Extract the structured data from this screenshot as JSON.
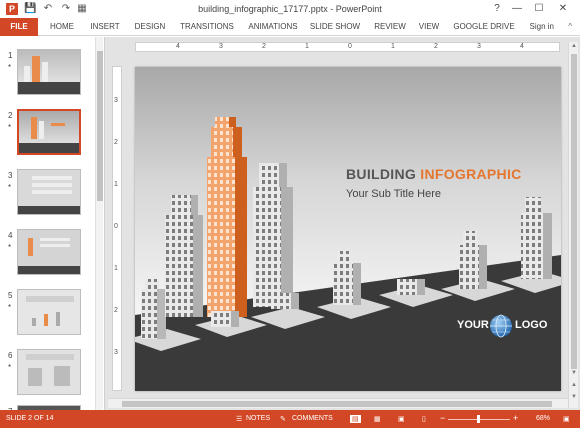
{
  "window": {
    "title": "building_infographic_17177.pptx - PowerPoint",
    "app_icon": "P",
    "controls": [
      "?",
      "—",
      "☐",
      "✕"
    ],
    "quick_access": [
      "save-icon",
      "undo-icon",
      "redo-icon",
      "start-icon"
    ]
  },
  "ribbon": {
    "tabs": [
      "FILE",
      "HOME",
      "INSERT",
      "DESIGN",
      "TRANSITIONS",
      "ANIMATIONS",
      "SLIDE SHOW",
      "REVIEW",
      "VIEW",
      "GOOGLE DRIVE"
    ],
    "signin": "Sign in",
    "collapse": "^"
  },
  "thumbnails": [
    {
      "num": "1",
      "star": "*"
    },
    {
      "num": "2",
      "star": "*"
    },
    {
      "num": "3",
      "star": "*"
    },
    {
      "num": "4",
      "star": "*"
    },
    {
      "num": "5",
      "star": "*"
    },
    {
      "num": "6",
      "star": "*"
    },
    {
      "num": "7",
      "star": ""
    }
  ],
  "ruler": {
    "horizontal": [
      "4",
      "3",
      "2",
      "1",
      "0",
      "1",
      "2",
      "3",
      "4"
    ],
    "vertical": [
      "3",
      "2",
      "1",
      "0",
      "1",
      "2",
      "3"
    ]
  },
  "slide": {
    "title_main": "BUILDING ",
    "title_accent": "INFOGRAPHIC",
    "subtitle": "Your Sub Title Here",
    "logo_left": "YOUR",
    "logo_right": "LOGO",
    "accent_color": "#e5762f",
    "road_color": "#3a3a3a"
  },
  "status": {
    "slide_info": "SLIDE 2 OF 14",
    "notes": "NOTES",
    "comments": "COMMENTS",
    "zoom_minus": "−",
    "zoom_plus": "+",
    "zoom": "68%"
  },
  "colors": {
    "brand": "#d24726"
  }
}
